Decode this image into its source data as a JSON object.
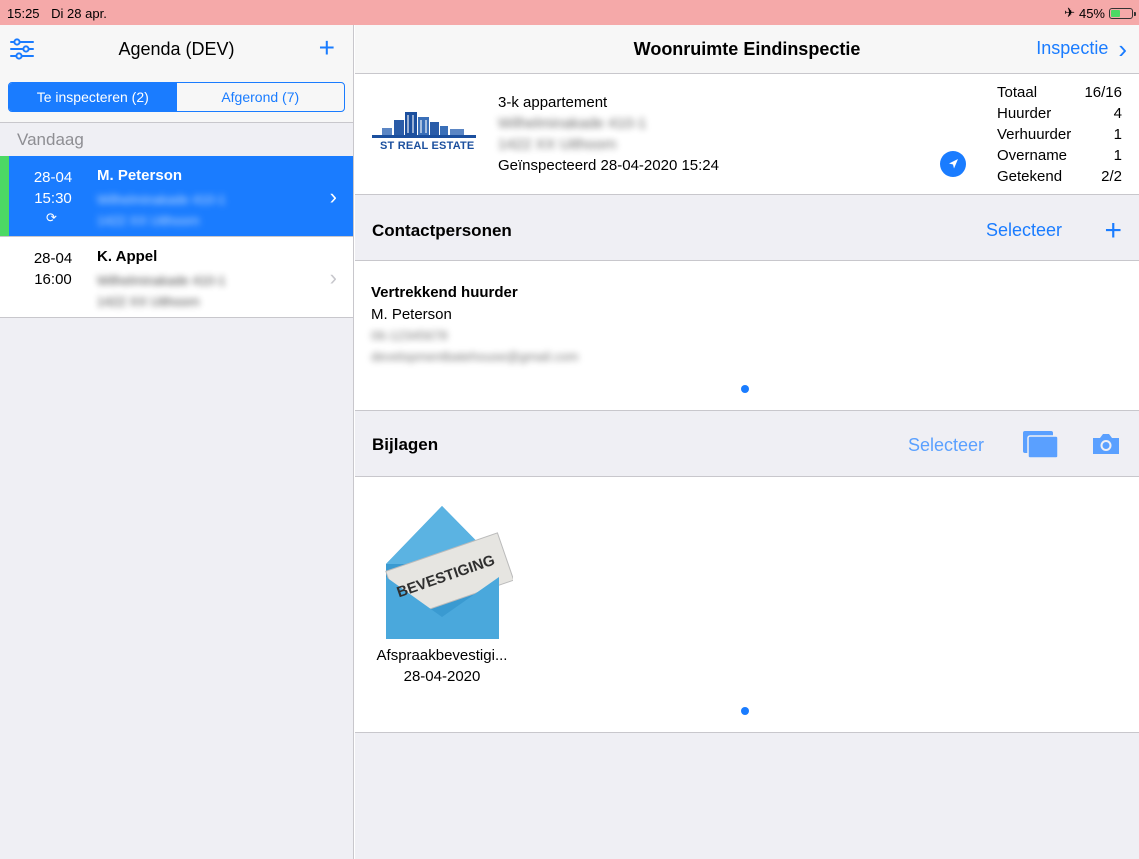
{
  "statusbar": {
    "time": "15:25",
    "date": "Di 28 apr.",
    "battery": "45%"
  },
  "master": {
    "title": "Agenda (DEV)",
    "segments": [
      "Te inspecteren (2)",
      "Afgerond (7)"
    ],
    "section": "Vandaag",
    "items": [
      {
        "date": "28-04",
        "time": "15:30",
        "name": "M. Peterson",
        "addr1": "Wilhelminakade 410-1",
        "addr2": "1422 XX Uithoorn"
      },
      {
        "date": "28-04",
        "time": "16:00",
        "name": "K. Appel",
        "addr1": "Wilhelminakade 410-1",
        "addr2": "1422 XX Uithoorn"
      }
    ]
  },
  "detail": {
    "title": "Woonruimte Eindinspectie",
    "right_button": "Inspectie",
    "object": {
      "logo_text": "ST REAL ESTATE",
      "type": "3-k appartement",
      "addr1": "Wilhelminakade 410-1",
      "addr2": "1422 XX Uithoorn",
      "inspected": "Geïnspecteerd 28-04-2020 15:24"
    },
    "stats": [
      {
        "label": "Totaal",
        "value": "16/16"
      },
      {
        "label": "Huurder",
        "value": "4"
      },
      {
        "label": "Verhuurder",
        "value": "1"
      },
      {
        "label": "Overname",
        "value": "1"
      },
      {
        "label": "Getekend",
        "value": "2/2"
      }
    ],
    "contacts": {
      "header": "Contactpersonen",
      "select": "Selecteer",
      "role": "Vertrekkend huurder",
      "name": "M. Peterson",
      "phone": "06-12345678",
      "email": "developmentbatehouse@gmail.com"
    },
    "attachments": {
      "header": "Bijlagen",
      "select": "Selecteer",
      "item_label": "BEVESTIGING",
      "item_name": "Afspraakbevestigi...",
      "item_date": "28-04-2020"
    }
  }
}
